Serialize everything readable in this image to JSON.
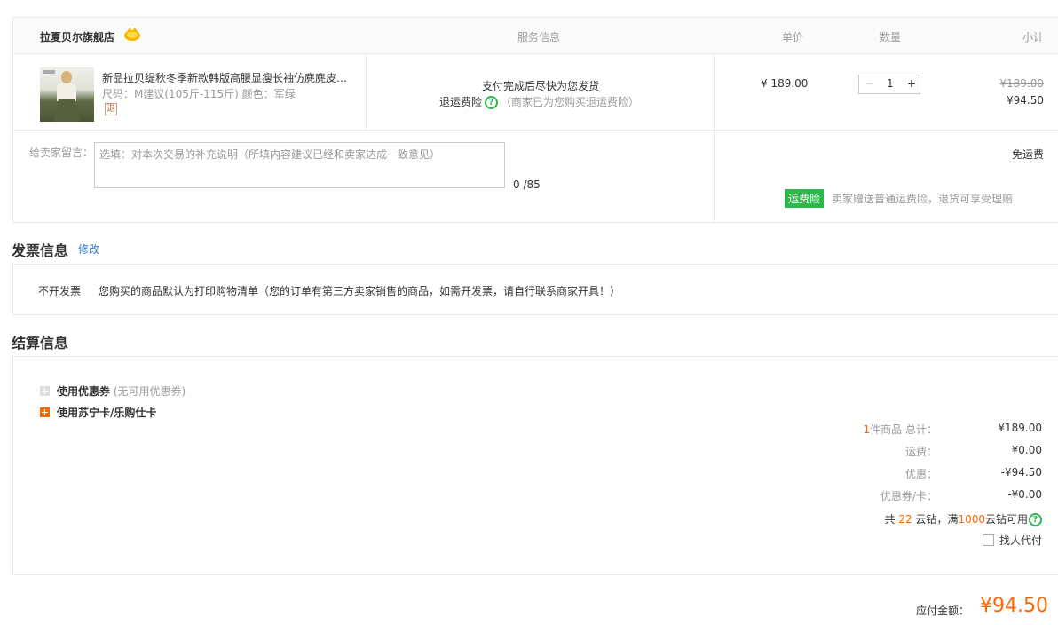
{
  "order": {
    "shop_name": "拉夏贝尔旗舰店",
    "columns": {
      "service": "服务信息",
      "unit_price": "单价",
      "quantity": "数量",
      "subtotal": "小计"
    },
    "colors": {
      "accent": "#ff6600",
      "insurance": "#2db84d",
      "link": "#2e7bcf"
    }
  },
  "product": {
    "name": "新品拉贝缇秋冬季新款韩版高腰显瘦长袖仿麂麂皮连衣裙",
    "spec": "尺码：M建议(105斤-115斤)   颜色：军绿",
    "return_badge": "退",
    "service_line1": "支付完成后尽快为您发货",
    "service_insurance": "退运费险",
    "service_note": "（商家已为您购买退运费险）",
    "unit_price": "¥ 189.00",
    "quantity": "1",
    "minus": "−",
    "plus": "+",
    "original_price": "¥189.00",
    "subtotal": "¥94.50"
  },
  "message": {
    "label": "给卖家留言：",
    "placeholder": "选填：对本次交易的补充说明（所填内容建议已经和卖家达成一致意见）",
    "value": "",
    "count": "0 /85"
  },
  "shipping": {
    "fee_label": "免运费",
    "insurance_badge": "运费险",
    "insurance_text": "卖家赠送普通运费险，退货可享受理赔"
  },
  "invoice": {
    "title": "发票信息",
    "edit_label": "修改",
    "type": "不开发票",
    "desc": "您购买的商品默认为打印购物清单（您的订单有第三方卖家销售的商品，如需开发票，请自行联系商家开具！）"
  },
  "settlement": {
    "title": "结算信息",
    "coupon_label": "使用优惠券",
    "coupon_note": "(无可用优惠券)",
    "card_label": "使用苏宁卡/乐购仕卡",
    "item_count": "1",
    "total_label": "件商品 总计：",
    "total_value": "¥189.00",
    "freight_label": "运费：",
    "freight_value": "¥0.00",
    "discount_label": "优惠：",
    "discount_value": "-¥94.50",
    "coupon_card_label": "优惠券/卡：",
    "coupon_card_value": "-¥0.00",
    "yun_prefix": "共",
    "yun_count": "22",
    "yun_mid": "云钻，满",
    "yun_threshold": "1000",
    "yun_suffix": "云钻可用",
    "proxy_label": "找人代付"
  },
  "payable": {
    "label": "应付金额：",
    "value": "¥94.50"
  }
}
